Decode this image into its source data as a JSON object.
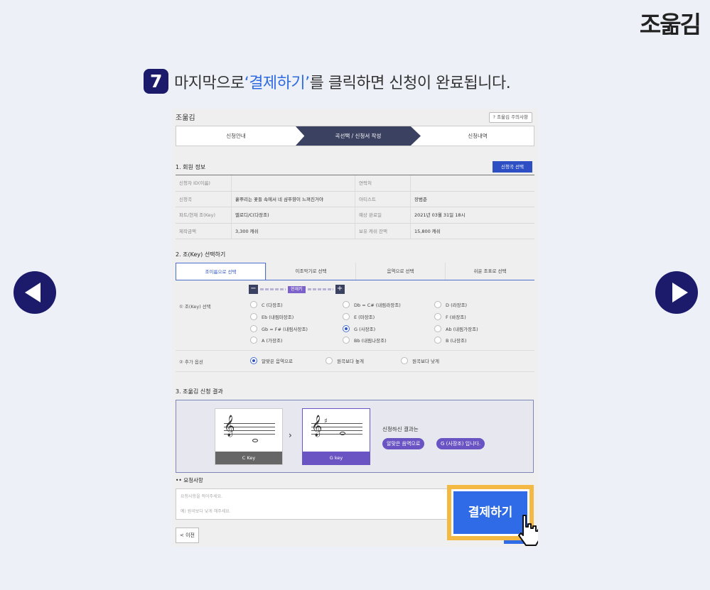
{
  "brand": "조욺김",
  "instruction": {
    "number": "7",
    "pre": "마지막으로 ",
    "highlight": "‘결제하기’",
    "post": "를 클릭하면 신청이 완료됩니다."
  },
  "nav": {
    "prev": "previous-arrow",
    "next": "next-arrow"
  },
  "screenshot": {
    "title": "조욺김",
    "notice_button": "? 조욺김 주의사항",
    "steps": [
      "신청안내",
      "곡선택 / 신청서 작성",
      "신청내역"
    ],
    "active_step": 1,
    "section1": "1. 회원 정보",
    "select_song_button": "신청곡 선택",
    "info_rows": [
      [
        "신청자 ID(이름)",
        "",
        "연락처",
        ""
      ],
      [
        "신청곡",
        "흩뿌리는 꽃들 속에서 네 샴푸향이 느껴진거야",
        "아티스트",
        "장범준"
      ],
      [
        "파트/현재 조(Key)",
        "멜로디/C(다장조)",
        "예상 완료일",
        "2021년 03월 31일 18시"
      ],
      [
        "제작금액",
        "3,300 캐쉬",
        "보유 캐쉬 잔액",
        "15,800 캐쉬"
      ]
    ],
    "section2": "2. 조(Key) 선택하기",
    "tabs": [
      "조이름으로 선택",
      "이조악기로 선택",
      "음역으로 선택",
      "쉬운 조표로 선택"
    ],
    "active_tab": 0,
    "current_key_label": "현재키",
    "key_select_label": "① 조(Key) 선택",
    "keys": [
      "C (다장조)",
      "Db = C# (내림라장조)",
      "D (라장조)",
      "Eb (내림마장조)",
      "E (마장조)",
      "F (바장조)",
      "Gb = F# (내림사장조)",
      "G (사장조)",
      "Ab (내림가장조)",
      "A (가장조)",
      "Bb (내림나장조)",
      "B (나장조)"
    ],
    "selected_key": "G (사장조)",
    "extra_label": "② 추가 옵션",
    "extra_options": [
      "알맞은 음역으로",
      "원곡보다 높게",
      "원곡보다 낮게"
    ],
    "selected_extra": "알맞은 음역으로",
    "section3": "3. 조욺김 신청 결과",
    "from_key_caption": "C Key",
    "to_key_caption": "G key",
    "result_label": "신청하신 결과는",
    "result_pill1": "알맞은 음역으로",
    "result_pill2": "G (사장조) 입니다.",
    "request_title": "•• 요청사항",
    "request_placeholder1": "요청사항을 적어주세요.",
    "request_placeholder2": "예) 원곡보다 낮게 해주세요.",
    "prev_button": "< 이전",
    "pay_button": "결제하기"
  }
}
